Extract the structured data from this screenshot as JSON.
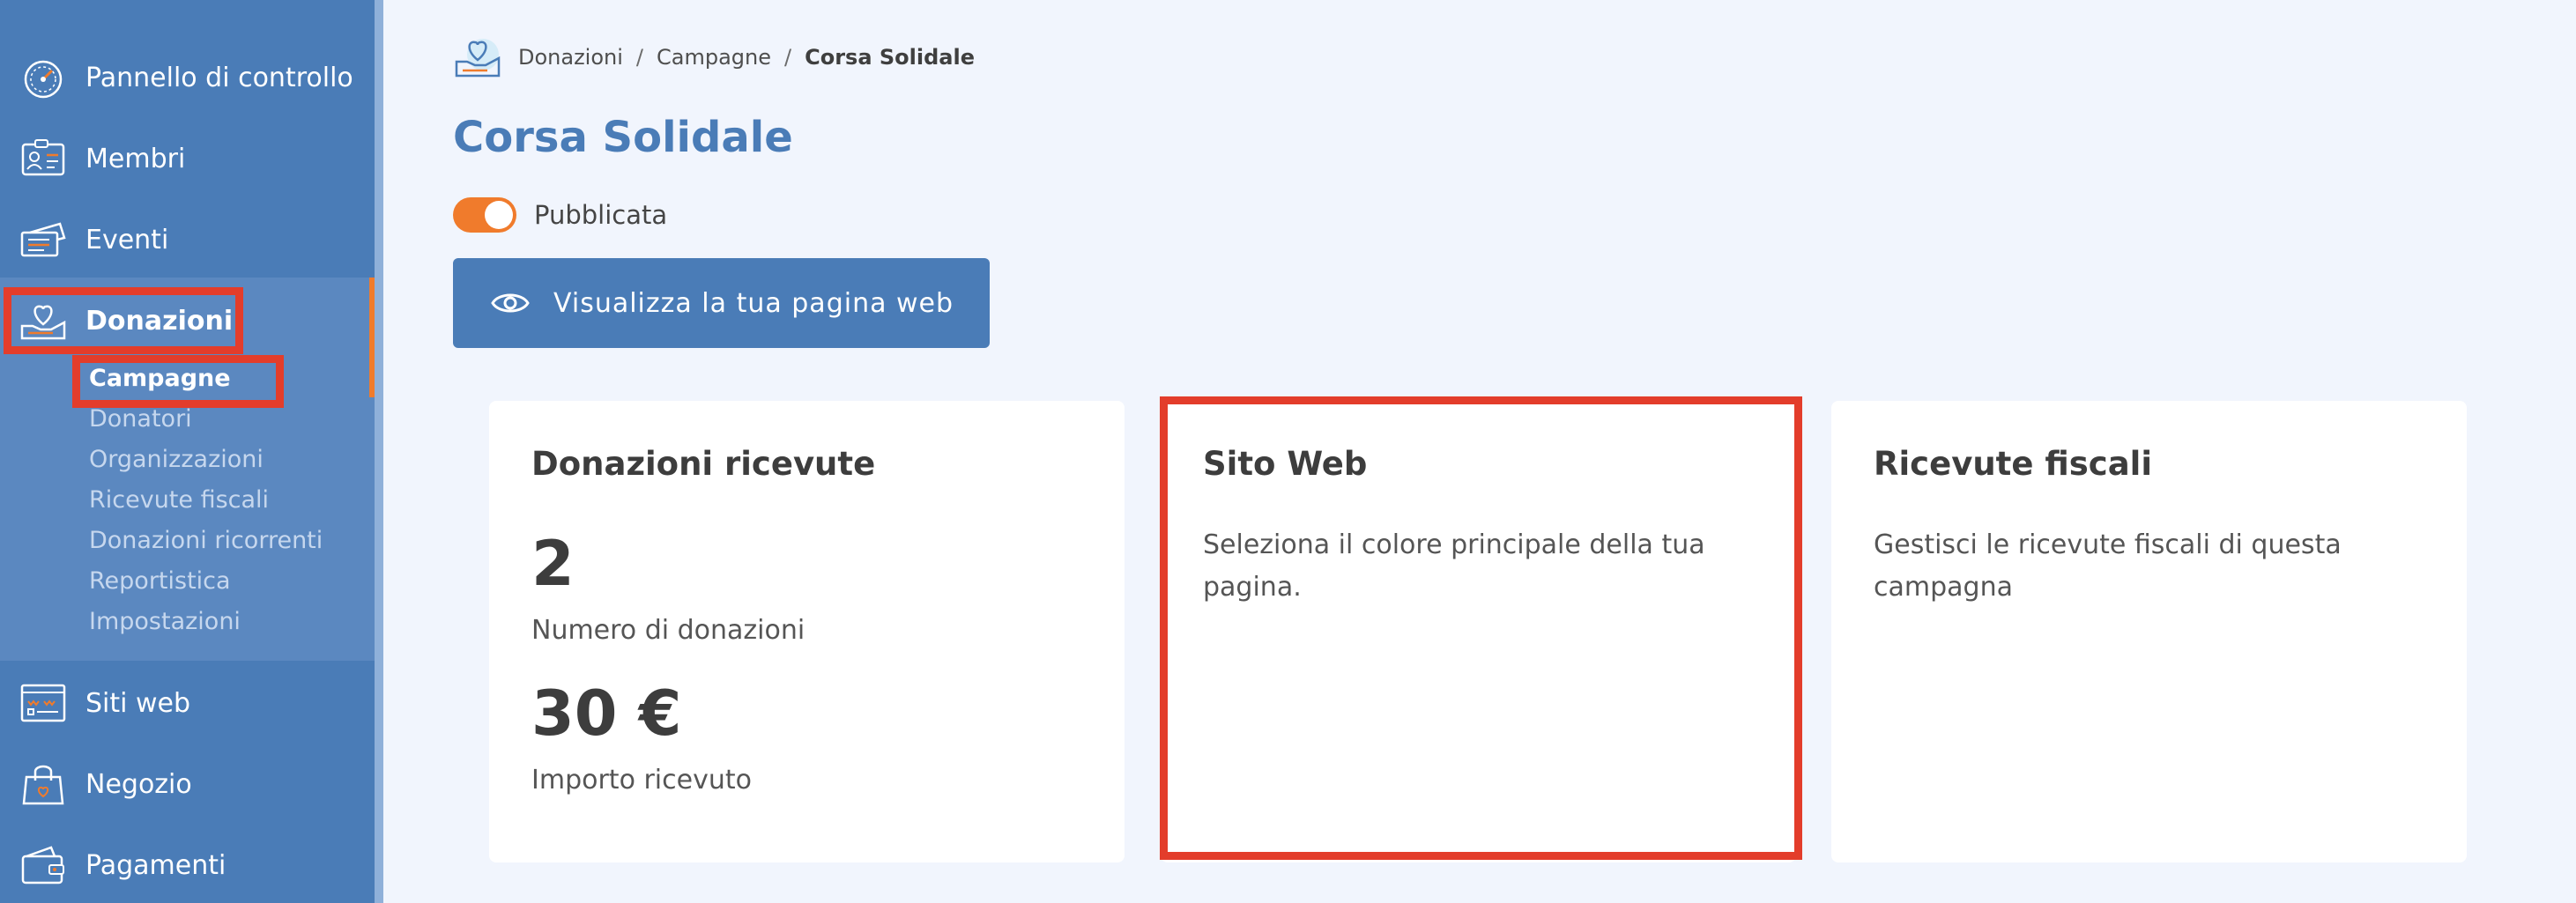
{
  "sidebar": {
    "items": [
      {
        "label": "Pannello di controllo",
        "icon": "dashboard-gauge-icon"
      },
      {
        "label": "Membri",
        "icon": "member-card-icon"
      },
      {
        "label": "Eventi",
        "icon": "event-tickets-icon"
      },
      {
        "label": "Donazioni",
        "icon": "donation-heart-hand-icon"
      },
      {
        "label": "Siti web",
        "icon": "website-icon"
      },
      {
        "label": "Negozio",
        "icon": "shopping-bag-icon"
      },
      {
        "label": "Pagamenti",
        "icon": "wallet-icon"
      }
    ],
    "donation_subitems": [
      "Campagne",
      "Donatori",
      "Organizzazioni",
      "Ricevute fiscali",
      "Donazioni ricorrenti",
      "Reportistica",
      "Impostazioni"
    ]
  },
  "breadcrumb": {
    "items": [
      "Donazioni",
      "Campagne"
    ],
    "current": "Corsa Solidale",
    "separator": "/"
  },
  "page": {
    "title": "Corsa Solidale",
    "toggle_label": "Pubblicata",
    "toggle_on": true,
    "view_button_label": "Visualizza la tua pagina web"
  },
  "cards": {
    "donations": {
      "title": "Donazioni ricevute",
      "count": "2",
      "count_label": "Numero di donazioni",
      "amount": "30 €",
      "amount_label": "Importo ricevuto"
    },
    "website": {
      "title": "Sito Web",
      "text": "Seleziona il colore principale della tua pagina."
    },
    "receipts": {
      "title": "Ricevute fiscali",
      "text": "Gestisci le ricevute fiscali di questa campagna"
    }
  },
  "colors": {
    "sidebar": "#4a7cb7",
    "sidebar_group": "#5b88c0",
    "accent": "#f07b2c",
    "highlight": "#e33d2b",
    "page_bg": "#f1f5fd"
  }
}
